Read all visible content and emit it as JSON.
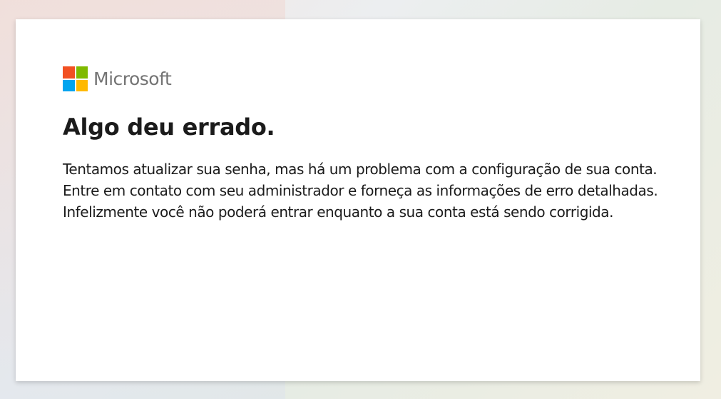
{
  "brand": {
    "name": "Microsoft",
    "logo_colors": [
      "#f25022",
      "#7fba00",
      "#00a4ef",
      "#ffb900"
    ]
  },
  "error": {
    "title": "Algo deu errado.",
    "message": "Tentamos atualizar sua senha, mas há um problema com a configuração de sua conta. Entre em contato com seu administrador e forneça as informações de erro detalhadas. Infelizmente você não poderá entrar enquanto a sua conta está sendo corrigida."
  }
}
